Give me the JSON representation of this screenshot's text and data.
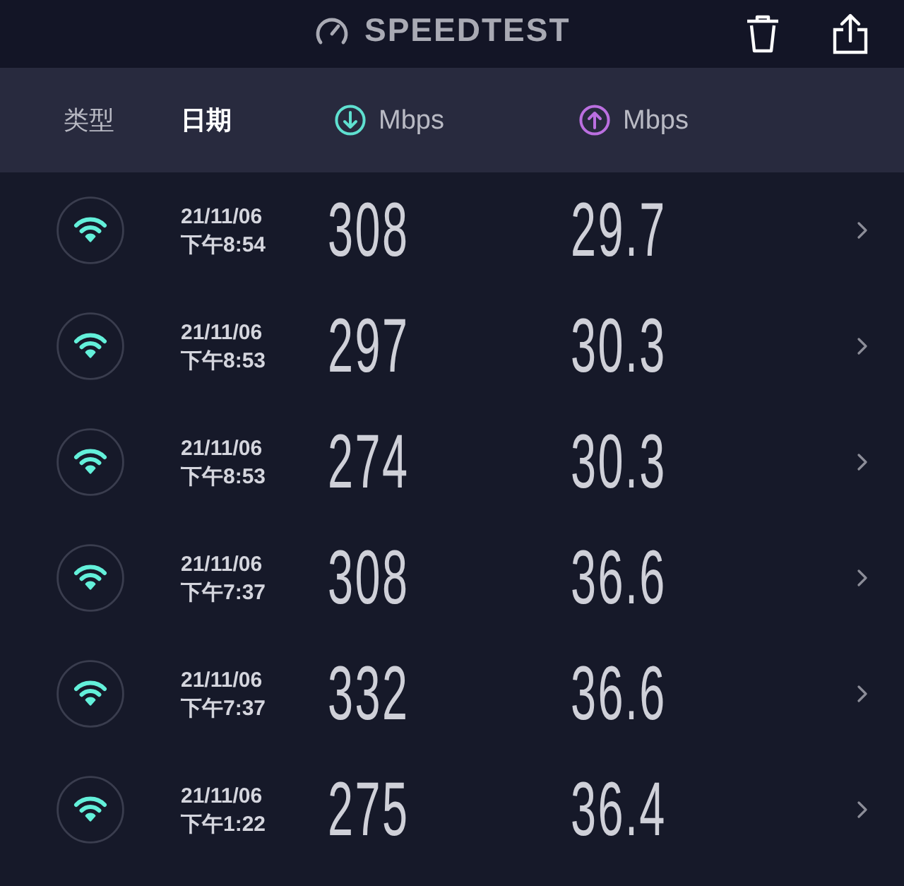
{
  "app_bar": {
    "title": "SPEEDTEST"
  },
  "columns": [
    {
      "kind": "text",
      "label": "类型",
      "selected": false
    },
    {
      "kind": "text",
      "label": "日期",
      "selected": true
    },
    {
      "kind": "download",
      "label": "Mbps",
      "selected": false
    },
    {
      "kind": "upload",
      "label": "Mbps",
      "selected": false
    }
  ],
  "results": [
    {
      "kind": "wifi",
      "date": "21/11/06",
      "time": "下午8:54",
      "download": "308",
      "upload": "29.7"
    },
    {
      "kind": "wifi",
      "date": "21/11/06",
      "time": "下午8:53",
      "download": "297",
      "upload": "30.3"
    },
    {
      "kind": "wifi",
      "date": "21/11/06",
      "time": "下午8:53",
      "download": "274",
      "upload": "30.3"
    },
    {
      "kind": "wifi",
      "date": "21/11/06",
      "time": "下午7:37",
      "download": "308",
      "upload": "36.6"
    },
    {
      "kind": "wifi",
      "date": "21/11/06",
      "time": "下午7:37",
      "download": "332",
      "upload": "36.6"
    },
    {
      "kind": "wifi",
      "date": "21/11/06",
      "time": "下午1:22",
      "download": "275",
      "upload": "36.4"
    }
  ]
}
